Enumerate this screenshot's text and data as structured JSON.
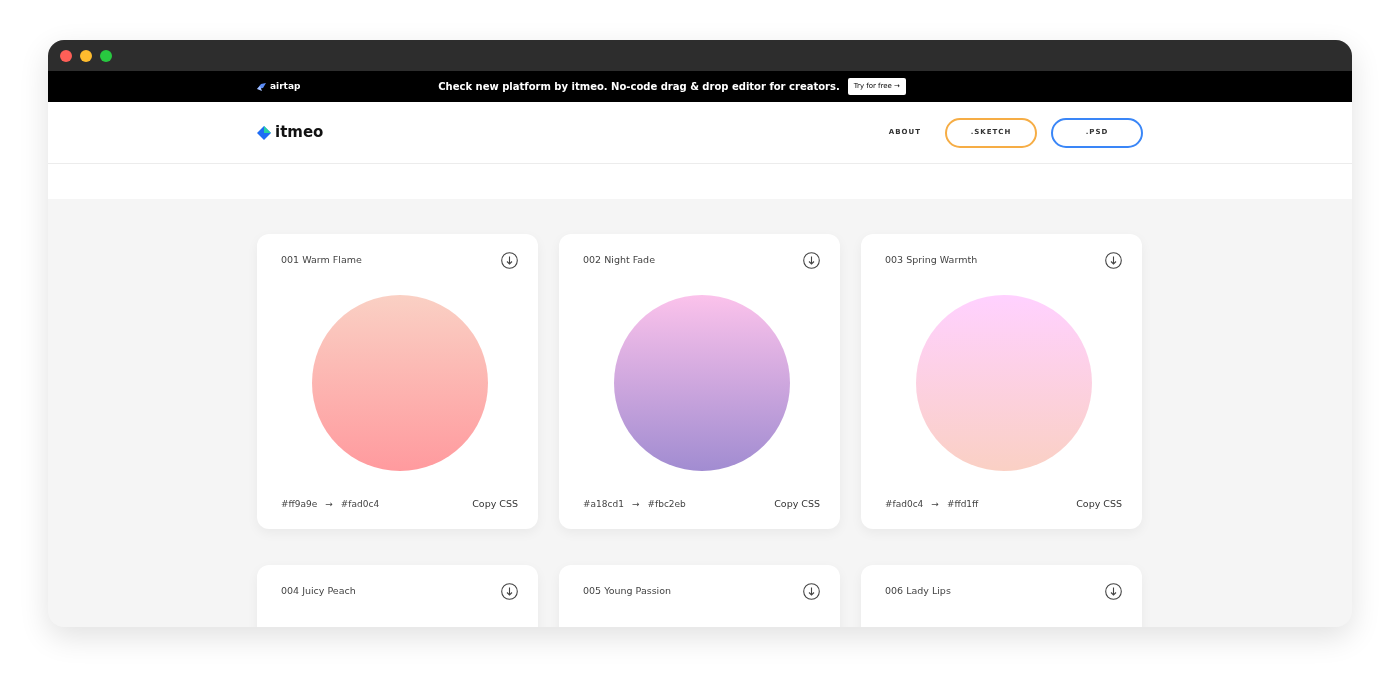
{
  "banner": {
    "brand": "airtap",
    "message": "Check new platform by itmeo. No-code drag & drop editor for creators.",
    "button": "Try for free",
    "button_arrow": "→"
  },
  "header": {
    "logo": "itmeo",
    "nav": [
      {
        "label": "ABOUT",
        "kind": "link"
      },
      {
        "label": ".SKETCH",
        "kind": "outline",
        "color": "#f6ad45"
      },
      {
        "label": ".PSD",
        "kind": "outline",
        "color": "#3a86f7"
      }
    ]
  },
  "gradients": [
    {
      "title": "001 Warm Flame",
      "from": "#ff9a9e",
      "to": "#fad0c4",
      "arrow": "→",
      "action": "Copy CSS"
    },
    {
      "title": "002 Night Fade",
      "from": "#a18cd1",
      "to": "#fbc2eb",
      "arrow": "→",
      "action": "Copy CSS"
    },
    {
      "title": "003 Spring Warmth",
      "from": "#fad0c4",
      "to": "#ffd1ff",
      "arrow": "→",
      "action": "Copy CSS"
    },
    {
      "title": "004 Juicy Peach"
    },
    {
      "title": "005 Young Passion"
    },
    {
      "title": "006 Lady Lips"
    }
  ]
}
